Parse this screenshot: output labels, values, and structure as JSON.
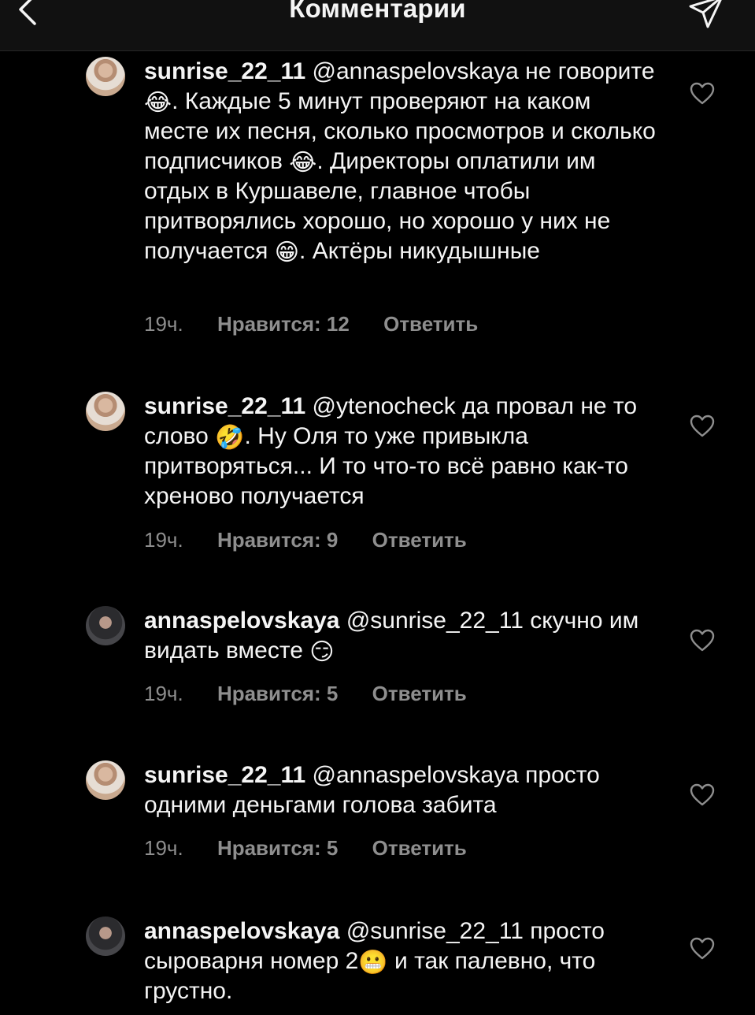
{
  "header": {
    "title": "Комментарии",
    "back_icon": "chevron-left-icon",
    "send_icon": "send-icon"
  },
  "comments": [
    {
      "username": "sunrise_22_11",
      "mention": "@annaspelovskaya",
      "text_parts": [
        "не говорите ",
        "😂",
        ". Каждые 5 минут проверяют на каком месте их песня, сколько просмотров и сколько подписчиков ",
        "😂",
        ". Директоры оплатили им отдых в Куршавеле, главное чтобы притворялись хорошо, но хорошо у них не получается ",
        "😁",
        ". Актёры никудышные"
      ],
      "time": "19ч.",
      "likes": "Нравится: 12",
      "reply": "Ответить"
    },
    {
      "username": "sunrise_22_11",
      "mention": "@ytenocheck",
      "text_parts": [
        "да провал не то слово ",
        "🤣",
        ". Ну Оля то уже привыкла притворяться... И то что-то всё равно как-то хреново получается"
      ],
      "time": "19ч.",
      "likes": "Нравится: 9",
      "reply": "Ответить"
    },
    {
      "username": "annaspelovskaya",
      "mention": "@sunrise_22_11",
      "text_parts": [
        " скучно им видать вместе ",
        "😏"
      ],
      "time": "19ч.",
      "likes": "Нравится: 5",
      "reply": "Ответить"
    },
    {
      "username": "sunrise_22_11",
      "mention": "@annaspelovskaya",
      "text_parts": [
        "просто одними деньгами голова забита"
      ],
      "time": "19ч.",
      "likes": "Нравится: 5",
      "reply": "Ответить"
    },
    {
      "username": "annaspelovskaya",
      "mention": "@sunrise_22_11",
      "text_parts": [
        "просто сыроварня номер 2",
        "😬",
        " и так палевно, что грустно."
      ],
      "time": "",
      "likes": "",
      "reply": ""
    }
  ],
  "colors": {
    "background": "#000000",
    "header_bg": "#111111",
    "text": "#f5f5f5",
    "secondary_text": "#8e8e8e"
  }
}
